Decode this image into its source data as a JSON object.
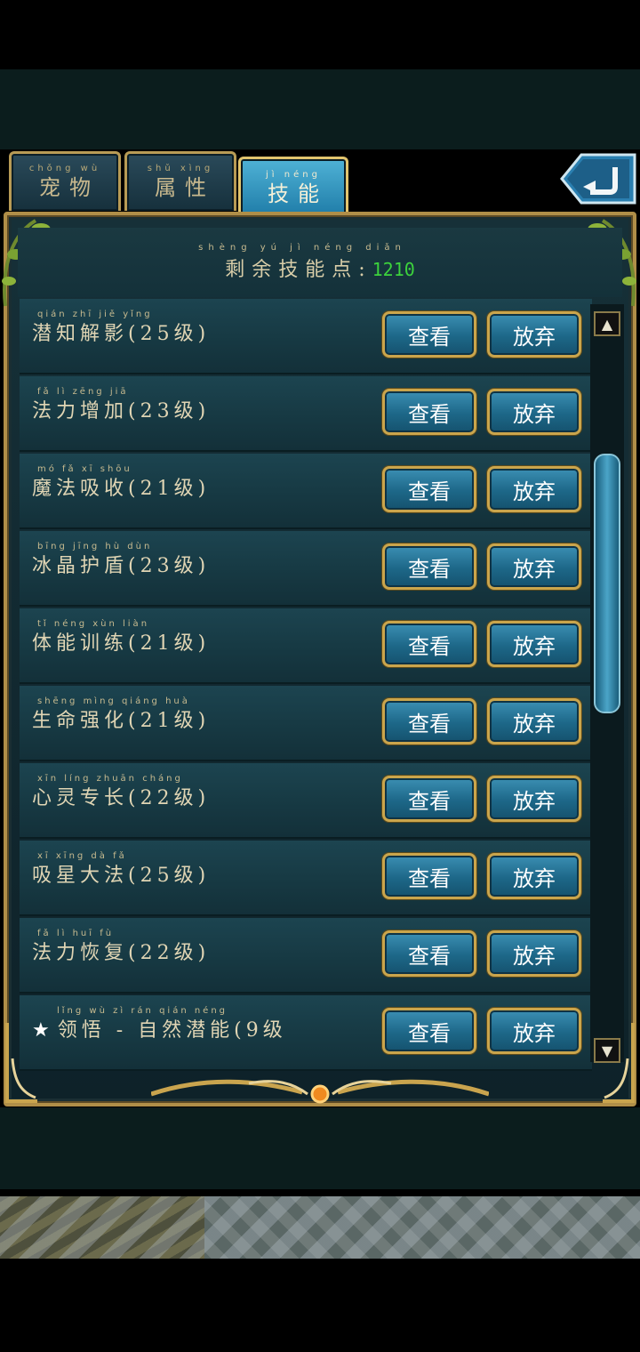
{
  "tabs": [
    {
      "pinyin": "chǒng wù",
      "label": "宠物",
      "active": false
    },
    {
      "pinyin": "shǔ xìng",
      "label": "属性",
      "active": false
    },
    {
      "pinyin": "jì néng",
      "label": "技能",
      "active": true
    }
  ],
  "header": {
    "pinyin": "shèng yú jì néng diǎn",
    "label": "剩余技能点:",
    "points": "1210"
  },
  "buttons": {
    "view_label": "查看",
    "drop_label": "放弃"
  },
  "skills": [
    {
      "pinyin": "qián zhī jiě yǐng",
      "name": "潜知解影(25级)"
    },
    {
      "pinyin": "fǎ lì zēng jiā",
      "name": "法力增加(23级)"
    },
    {
      "pinyin": "mó fǎ xī shōu",
      "name": "魔法吸收(21级)"
    },
    {
      "pinyin": "bīng jīng hù dùn",
      "name": "冰晶护盾(23级)"
    },
    {
      "pinyin": "tǐ néng xùn liàn",
      "name": "体能训练(21级)"
    },
    {
      "pinyin": "shēng mìng qiáng huà",
      "name": "生命强化(21级)"
    },
    {
      "pinyin": "xīn líng zhuān cháng",
      "name": "心灵专长(22级)"
    },
    {
      "pinyin": "xī xīng dà fǎ",
      "name": "吸星大法(25级)"
    },
    {
      "pinyin": "fǎ lì huī fù",
      "name": "法力恢复(22级)"
    },
    {
      "pinyin": "lǐng wù  zì rán qián néng",
      "name": "领悟 - 自然潜能(9级",
      "starred": true
    }
  ],
  "colors": {
    "points": "#3cd23c",
    "gold_border": "#caa54c",
    "button_blue": "#1d6788"
  }
}
